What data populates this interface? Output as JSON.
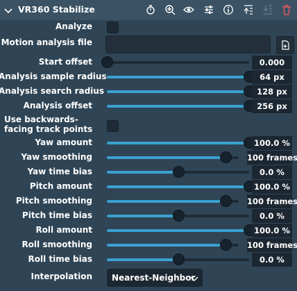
{
  "header": {
    "title": "VR360 Stabilize",
    "icons": [
      "chevron-down-icon",
      "stopwatch-icon",
      "zoom-icon",
      "eye-icon",
      "sliders-icon",
      "info-icon",
      "move-up-icon",
      "move-down-icon",
      "trash-icon"
    ]
  },
  "fields": {
    "analyze": {
      "label": "Analyze",
      "checked": false
    },
    "motion_file": {
      "label": "Motion analysis file",
      "value": ""
    },
    "start_offset": {
      "label": "Start offset",
      "value": "0.000",
      "fraction": 0.0
    },
    "sample_radius": {
      "label": "Analysis sample radius",
      "value": "64 px",
      "fraction": 1.0
    },
    "search_radius": {
      "label": "Analysis search radius",
      "value": "128 px",
      "fraction": 1.0
    },
    "analysis_offset": {
      "label": "Analysis offset",
      "value": "256 px",
      "fraction": 1.0
    },
    "backwards": {
      "label": "Use backwards-facing track points",
      "checked": false
    },
    "yaw_amount": {
      "label": "Yaw amount",
      "value": "100.0 %",
      "fraction": 1.0
    },
    "yaw_smoothing": {
      "label": "Yaw smoothing",
      "value": "100 frames",
      "fraction": 0.9
    },
    "yaw_bias": {
      "label": "Yaw time bias",
      "value": "0.0 %",
      "fraction": 0.5
    },
    "pitch_amount": {
      "label": "Pitch amount",
      "value": "100.0 %",
      "fraction": 1.0
    },
    "pitch_smoothing": {
      "label": "Pitch smoothing",
      "value": "100 frames",
      "fraction": 0.9
    },
    "pitch_bias": {
      "label": "Pitch time bias",
      "value": "0.0 %",
      "fraction": 0.5
    },
    "roll_amount": {
      "label": "Roll amount",
      "value": "100.0 %",
      "fraction": 1.0
    },
    "roll_smoothing": {
      "label": "Roll smoothing",
      "value": "100 frames",
      "fraction": 0.9
    },
    "roll_bias": {
      "label": "Roll time bias",
      "value": "0.0 %",
      "fraction": 0.5
    },
    "interpolation": {
      "label": "Interpolation",
      "value": "Nearest-Neighbor"
    }
  },
  "colors": {
    "background": "#2f4556",
    "accent": "#3aa1cf",
    "delete": "#e0585d"
  }
}
